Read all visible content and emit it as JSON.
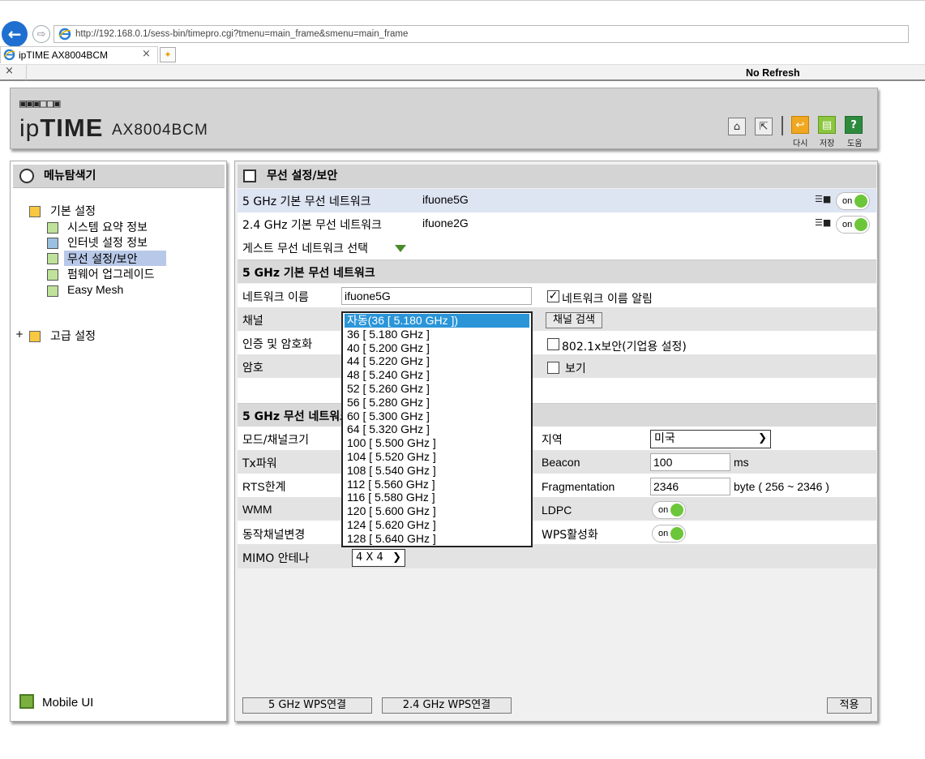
{
  "browser": {
    "address": "http://192.168.0.1/sess-bin/timepro.cgi?tmenu=main_frame&smenu=main_frame",
    "tab_title": "ipTIME AX8004BCM",
    "tab_close": "×",
    "close_glyph": "×",
    "no_refresh": "No Refresh"
  },
  "header": {
    "brand": "ipTIME",
    "model": "AX8004BCM",
    "retry_label": "다시",
    "save_label": "저장",
    "help_label": "도움"
  },
  "sidebar": {
    "title": "메뉴탐색기",
    "basic_label": "기본 설정",
    "items": [
      {
        "label": "시스템 요약 정보"
      },
      {
        "label": "인터넷 설정 정보"
      },
      {
        "label": "무선 설정/보안"
      },
      {
        "label": "펌웨어 업그레이드"
      },
      {
        "label": "Easy Mesh"
      }
    ],
    "advanced_label": "고급 설정",
    "mobile_label": "Mobile UI"
  },
  "main": {
    "title": "무선 설정/보안",
    "networks": [
      {
        "label": "5 GHz 기본 무선 네트워크",
        "ssid": "ifuone5G",
        "toggle": "on"
      },
      {
        "label": "2.4 GHz 기본 무선 네트워크",
        "ssid": "ifuone2G",
        "toggle": "on"
      }
    ],
    "guest_select": "게스트 무선 네트워크 선택",
    "section_basic": "5 GHz 기본 무선 네트워크",
    "network_name_label": "네트워크 이름",
    "network_name_value": "ifuone5G",
    "broadcast_label": "네트워크 이름 알림",
    "channel_label": "채널",
    "channel_scan": "채널 검색",
    "auth_label": "인증 및 암호화",
    "dot1x_label": "802.1x보안(기업용 설정)",
    "password_label": "암호",
    "show_label": "보기",
    "section_advanced": "5 GHz 무선 네트워크",
    "mode_label": "모드/채널크기",
    "txpower_label": "Tx파워",
    "rts_label": "RTS한계",
    "wmm_label": "WMM",
    "dfs_label": "동작채널변경",
    "mimo_label": "MIMO 안테나",
    "mimo_value": "4 X 4",
    "region_label": "지역",
    "region_value": "미국",
    "beacon_label": "Beacon",
    "beacon_value": "100",
    "beacon_unit": "ms",
    "frag_label": "Fragmentation",
    "frag_value": "2346",
    "frag_unit": "byte ( 256 ~ 2346 )",
    "ldpc_label": "LDPC",
    "ldpc_toggle": "on",
    "wps_label": "WPS활성화",
    "wps_toggle": "on",
    "btn_wps5": "5 GHz WPS연결",
    "btn_wps24": "2.4 GHz WPS연결",
    "btn_apply": "적용"
  },
  "channel_dropdown": {
    "options": [
      "자동(36 [ 5.180 GHz ])",
      "36 [ 5.180 GHz ]",
      "40 [ 5.200 GHz ]",
      "44 [ 5.220 GHz ]",
      "48 [ 5.240 GHz ]",
      "52 [ 5.260 GHz ]",
      "56 [ 5.280 GHz ]",
      "60 [ 5.300 GHz ]",
      "64 [ 5.320 GHz ]",
      "100 [ 5.500 GHz ]",
      "104 [ 5.520 GHz ]",
      "108 [ 5.540 GHz ]",
      "112 [ 5.560 GHz ]",
      "116 [ 5.580 GHz ]",
      "120 [ 5.600 GHz ]",
      "124 [ 5.620 GHz ]",
      "128 [ 5.640 GHz ]"
    ],
    "selected_index": 0
  },
  "colors": {
    "selected_option": "#2b95d8",
    "toggle_knob": "#6cc63a",
    "panel_header": "#d4d4d4"
  }
}
